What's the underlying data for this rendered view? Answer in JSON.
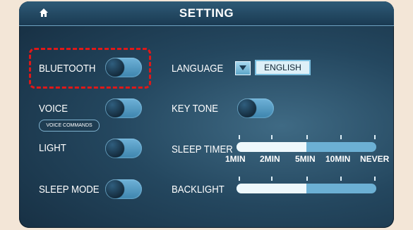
{
  "header": {
    "title": "SETTING",
    "home_icon": "home-icon"
  },
  "bluetooth": {
    "label": "BLUETOOTH",
    "on": true
  },
  "voice": {
    "label": "VOICE",
    "on": true,
    "commands_button": "VOICE COMMANDS"
  },
  "light": {
    "label": "LIGHT",
    "on": true
  },
  "sleep_mode": {
    "label": "SLEEP MODE",
    "on": true
  },
  "language": {
    "label": "LANGUAGE",
    "value": "ENGLISH"
  },
  "key_tone": {
    "label": "KEY TONE",
    "on": true
  },
  "sleep_timer": {
    "label": "SLEEP TIMER",
    "options": [
      "1MIN",
      "2MIN",
      "5MIN",
      "10MIN",
      "NEVER"
    ],
    "level": 0.5
  },
  "backlight": {
    "label": "BACKLIGHT",
    "level": 0.5
  },
  "colors": {
    "accent": "#6cb0d4",
    "highlight": "#e01818",
    "panel": "#24475f"
  }
}
